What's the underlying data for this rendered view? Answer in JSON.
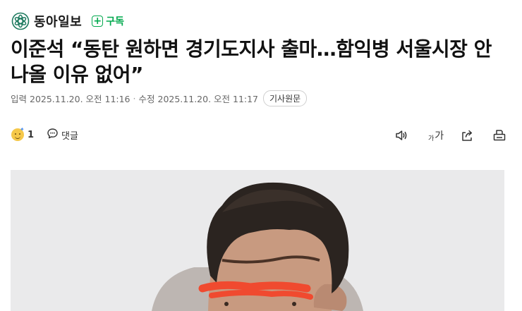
{
  "press": {
    "name": "동아일보",
    "subscribe_label": "구독"
  },
  "article": {
    "title": "이준석 “동탄 원하면 경기도지사 출마…함익병 서울시장 안 나올 이유 없어”",
    "published_label": "입력",
    "published": "2025.11.20. 오전 11:16",
    "separator": "·",
    "modified_label": "수정",
    "modified": "2025.11.20. 오전 11:17",
    "original_button": "기사원문"
  },
  "toolbar": {
    "reaction_count": "1",
    "comment_label": "댓글",
    "font_small": "가",
    "font_large": "가"
  },
  "colors": {
    "subscribe_green": "#03a94f",
    "logo_green": "#1d7a5f",
    "redaction": "#f04a2f"
  },
  "icons": [
    "dongA-logo-icon",
    "plus-icon",
    "reaction-emoji-icon",
    "comment-icon",
    "speaker-icon",
    "share-icon",
    "print-icon"
  ]
}
